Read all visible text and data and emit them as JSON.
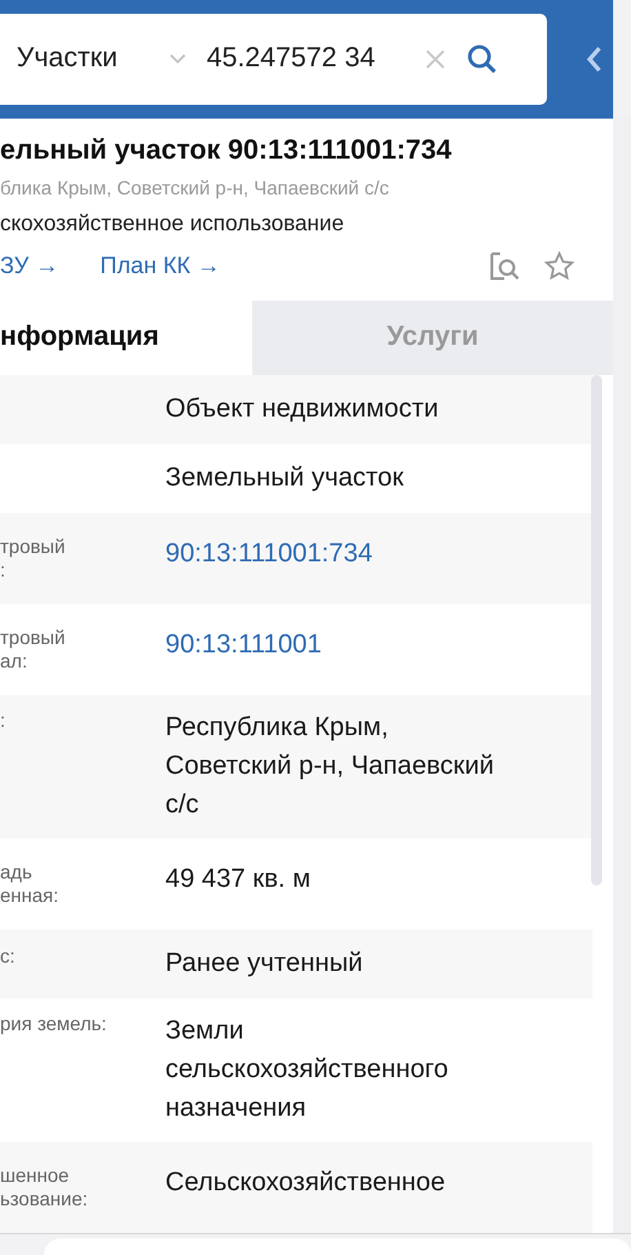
{
  "search_bar": {
    "category": "Участки",
    "query": "45.247572 34"
  },
  "card": {
    "title": "ельный участок 90:13:111001:734",
    "address": "блика Крым, Советский р-н, Чапаевский с/с",
    "usage": "скохозяйственное использование",
    "links": [
      "ЗУ →",
      "План КК →"
    ]
  },
  "tabs": [
    {
      "label": "нформация",
      "selected": true
    },
    {
      "label": "Услуги",
      "selected": false
    }
  ],
  "rows": [
    {
      "label": [],
      "value": [
        "Объект недвижимости"
      ],
      "kind": "text"
    },
    {
      "label": [],
      "value": [
        "Земельный участок"
      ],
      "kind": "text"
    },
    {
      "label": [
        "тровый",
        ":"
      ],
      "value": [
        "90:13:111001:734"
      ],
      "kind": "link"
    },
    {
      "label": [
        "тровый",
        "ал:"
      ],
      "value": [
        "90:13:111001"
      ],
      "kind": "link"
    },
    {
      "label": [
        ":"
      ],
      "value": [
        "Республика Крым,",
        "Советский р-н, Чапаевский",
        "с/с"
      ],
      "kind": "text"
    },
    {
      "label": [
        "адь",
        "енная:"
      ],
      "value": [
        "49 437 кв. м"
      ],
      "kind": "text"
    },
    {
      "label": [
        "с:"
      ],
      "value": [
        "Ранее учтенный"
      ],
      "kind": "text"
    },
    {
      "label": [
        "рия земель:"
      ],
      "value": [
        "Земли",
        "сельскохозяйственного",
        "назначения"
      ],
      "kind": "text"
    },
    {
      "label": [
        "шенное",
        "ьзование:"
      ],
      "value": [
        "Сельскохозяйственное"
      ],
      "kind": "text"
    }
  ]
}
